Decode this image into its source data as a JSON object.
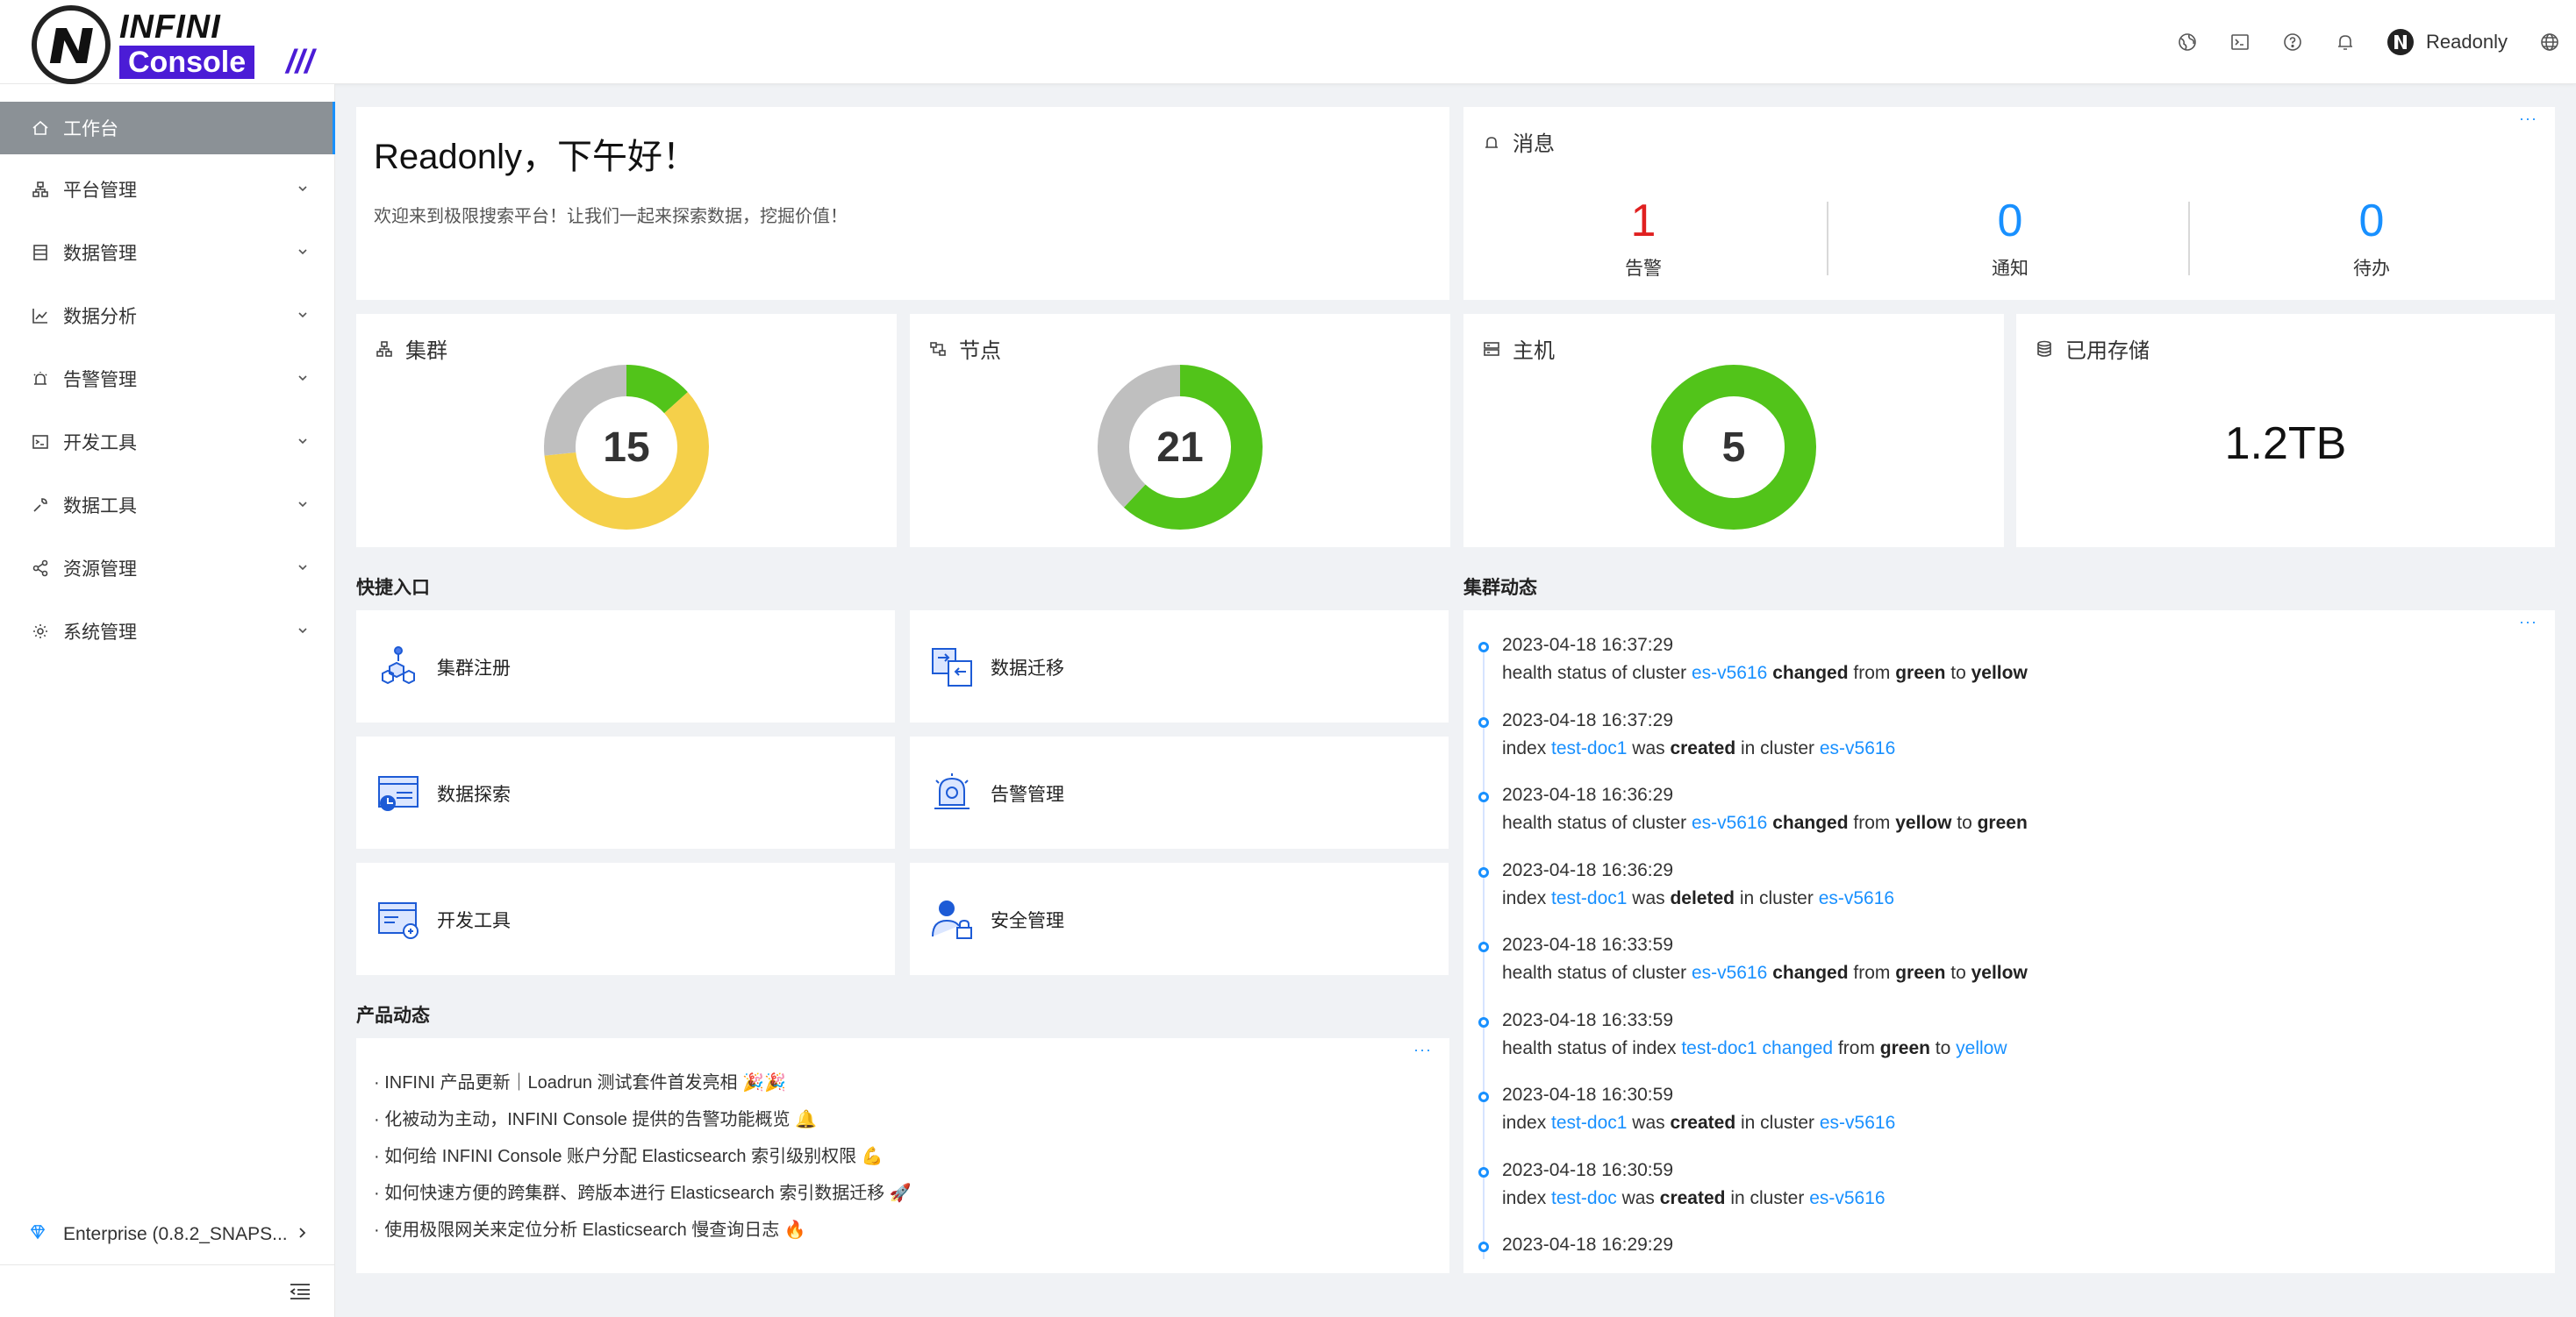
{
  "header": {
    "logo_infini": "INFINI",
    "logo_console": "Console",
    "logo_slashes": "///",
    "username": "Readonly",
    "icons": [
      "language-globe-icon",
      "terminal-icon",
      "help-icon",
      "bell-icon",
      "globe-icon"
    ]
  },
  "sidebar": {
    "items": [
      {
        "label": "工作台",
        "icon": "home-icon",
        "active": true
      },
      {
        "label": "平台管理",
        "icon": "cluster-icon"
      },
      {
        "label": "数据管理",
        "icon": "database-icon"
      },
      {
        "label": "数据分析",
        "icon": "chart-icon"
      },
      {
        "label": "告警管理",
        "icon": "alarm-icon"
      },
      {
        "label": "开发工具",
        "icon": "code-icon"
      },
      {
        "label": "数据工具",
        "icon": "wrench-icon"
      },
      {
        "label": "资源管理",
        "icon": "share-icon"
      },
      {
        "label": "系统管理",
        "icon": "gear-icon"
      }
    ],
    "footer_label": "Enterprise (0.8.2_SNAPS..."
  },
  "greeting": {
    "title": "Readonly，下午好！",
    "subtitle": "欢迎来到极限搜索平台！让我们一起来探索数据，挖掘价值！"
  },
  "messages": {
    "title": "消息",
    "items": [
      {
        "value": "1",
        "label": "告警",
        "color": "#e02020"
      },
      {
        "value": "0",
        "label": "通知",
        "color": "#1890ff"
      },
      {
        "value": "0",
        "label": "待办",
        "color": "#1890ff"
      }
    ]
  },
  "stats": {
    "cluster": {
      "title": "集群",
      "value": "15",
      "segments": [
        {
          "status": "green",
          "count": 2,
          "color": "#52c41a"
        },
        {
          "status": "yellow",
          "count": 9,
          "color": "#f5d04a"
        },
        {
          "status": "unavailable",
          "count": 4,
          "color": "#bfbfbf"
        }
      ]
    },
    "node": {
      "title": "节点",
      "value": "21",
      "segments": [
        {
          "status": "green",
          "count": 13,
          "color": "#52c41a"
        },
        {
          "status": "unavailable",
          "count": 8,
          "color": "#bfbfbf"
        }
      ]
    },
    "host": {
      "title": "主机",
      "value": "5",
      "segments": [
        {
          "status": "green",
          "count": 5,
          "color": "#52c41a"
        }
      ]
    },
    "storage": {
      "title": "已用存储",
      "value": "1.2TB"
    }
  },
  "quick_entry": {
    "title": "快捷入口",
    "items": [
      {
        "label": "集群注册",
        "icon": "cluster-register-icon"
      },
      {
        "label": "数据迁移",
        "icon": "data-migration-icon"
      },
      {
        "label": "数据探索",
        "icon": "data-explore-icon"
      },
      {
        "label": "告警管理",
        "icon": "alert-manage-icon"
      },
      {
        "label": "开发工具",
        "icon": "dev-tools-icon"
      },
      {
        "label": "安全管理",
        "icon": "security-icon"
      }
    ]
  },
  "product_news": {
    "title": "产品动态",
    "items": [
      "· INFINI 产品更新｜Loadrun 测试套件首发亮相 🎉🎉",
      "· 化被动为主动，INFINI Console 提供的告警功能概览 🔔",
      "· 如何给 INFINI Console 账户分配 Elasticsearch 索引级别权限 💪",
      "· 如何快速方便的跨集群、跨版本进行 Elasticsearch 索引数据迁移 🚀",
      "· 使用极限网关来定位分析 Elasticsearch 慢查询日志 🔥"
    ]
  },
  "cluster_activity": {
    "title": "集群动态",
    "events": [
      {
        "time": "2023-04-18 16:37:29",
        "parts": [
          [
            "t",
            "health status of cluster "
          ],
          [
            "l",
            "es-v5616"
          ],
          [
            "t",
            " "
          ],
          [
            "b",
            "changed"
          ],
          [
            "t",
            " from "
          ],
          [
            "b",
            "green"
          ],
          [
            "t",
            " to "
          ],
          [
            "b",
            "yellow"
          ]
        ]
      },
      {
        "time": "2023-04-18 16:37:29",
        "parts": [
          [
            "t",
            "index "
          ],
          [
            "l",
            "test-doc1"
          ],
          [
            "t",
            " was "
          ],
          [
            "b",
            "created"
          ],
          [
            "t",
            " in cluster "
          ],
          [
            "l",
            "es-v5616"
          ]
        ]
      },
      {
        "time": "2023-04-18 16:36:29",
        "parts": [
          [
            "t",
            "health status of cluster "
          ],
          [
            "l",
            "es-v5616"
          ],
          [
            "t",
            " "
          ],
          [
            "b",
            "changed"
          ],
          [
            "t",
            " from "
          ],
          [
            "b",
            "yellow"
          ],
          [
            "t",
            " to "
          ],
          [
            "b",
            "green"
          ]
        ]
      },
      {
        "time": "2023-04-18 16:36:29",
        "parts": [
          [
            "t",
            "index "
          ],
          [
            "l",
            "test-doc1"
          ],
          [
            "t",
            " was "
          ],
          [
            "b",
            "deleted"
          ],
          [
            "t",
            " in cluster "
          ],
          [
            "l",
            "es-v5616"
          ]
        ]
      },
      {
        "time": "2023-04-18 16:33:59",
        "parts": [
          [
            "t",
            "health status of cluster "
          ],
          [
            "l",
            "es-v5616"
          ],
          [
            "t",
            " "
          ],
          [
            "b",
            "changed"
          ],
          [
            "t",
            " from "
          ],
          [
            "b",
            "green"
          ],
          [
            "t",
            " to "
          ],
          [
            "b",
            "yellow"
          ]
        ]
      },
      {
        "time": "2023-04-18 16:33:59",
        "parts": [
          [
            "t",
            "health status of index "
          ],
          [
            "l",
            "test-doc1 changed"
          ],
          [
            "t",
            " from "
          ],
          [
            "b",
            "green"
          ],
          [
            "t",
            " to "
          ],
          [
            "l",
            "yellow"
          ]
        ]
      },
      {
        "time": "2023-04-18 16:30:59",
        "parts": [
          [
            "t",
            "index "
          ],
          [
            "l",
            "test-doc1"
          ],
          [
            "t",
            " was "
          ],
          [
            "b",
            "created"
          ],
          [
            "t",
            " in cluster "
          ],
          [
            "l",
            "es-v5616"
          ]
        ]
      },
      {
        "time": "2023-04-18 16:30:59",
        "parts": [
          [
            "t",
            "index "
          ],
          [
            "l",
            "test-doc"
          ],
          [
            "t",
            " was "
          ],
          [
            "b",
            "created"
          ],
          [
            "t",
            " in cluster "
          ],
          [
            "l",
            "es-v5616"
          ]
        ]
      },
      {
        "time": "2023-04-18 16:29:29",
        "parts": []
      }
    ]
  }
}
